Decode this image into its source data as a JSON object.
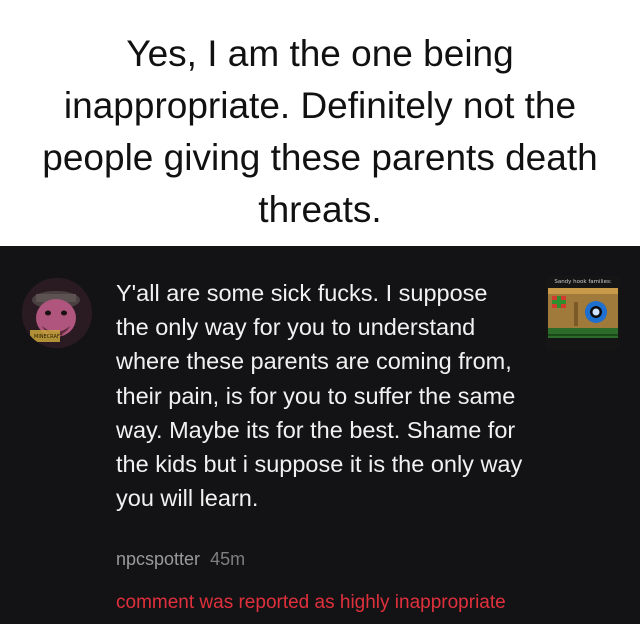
{
  "caption": {
    "text": "Yes, I am the one being inappropriate. Definitely not the people giving these parents death threats."
  },
  "comment": {
    "avatar_icon": "user-avatar-icon",
    "avatar_badge": "MINECRAFT",
    "body": "Y'all are some sick fucks. I suppose the only way for you to understand where these parents are coming from, their pain, is for you to suffer the same way. Maybe its for the best. Shame for the kids but i suppose it is the only way you will learn.",
    "username": "npcspotter",
    "timestamp": "45m",
    "reported_notice": "comment was reported as highly inappropriate",
    "thumbnail_title": "Sandy hook families:",
    "thumbnail_icon": "video-thumbnail-icon",
    "colors": {
      "background": "#131315",
      "text": "#f1f1f1",
      "meta": "#9a9a9a",
      "reported": "#e0303c"
    }
  }
}
